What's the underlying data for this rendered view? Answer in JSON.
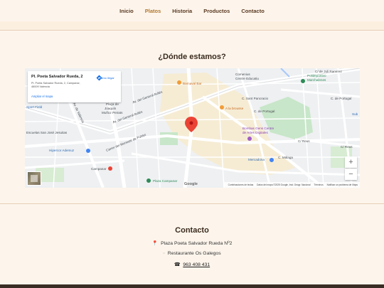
{
  "nav": {
    "items": [
      {
        "label": "Inicio"
      },
      {
        "label": "Platos",
        "active": true
      },
      {
        "label": "Historia"
      },
      {
        "label": "Productos"
      },
      {
        "label": "Contacto"
      }
    ]
  },
  "location": {
    "title": "¿Dónde estamos?",
    "map": {
      "place_name": "Pl. Poeta Salvador Rueda, 2",
      "place_address": "Pl. Poeta Salvador Rueda, 2, Campanar, 46009 Valencia",
      "directions_label": "Cómo llegar",
      "larger_map_label": "Ampliar el mapa",
      "zoom_in": "+",
      "zoom_out": "−",
      "attribution": {
        "shortcuts": "Combinaciones de teclas",
        "data": "Datos del mapa ©2025 Google, Inst. Geogr. Nacional",
        "terms": "Términos",
        "report": "Notificar un problema de Maps"
      },
      "google": "Google",
      "labels": {
        "carrer_de_juli_ramirez": "C/ de Juli Ramírez",
        "comenius": "Comenius",
        "centre_educatiu": "Centre Educatiu",
        "polideportivo": "Polideportivo",
        "marchalenes": "Marchalenes",
        "barnaval": "Barnaval Bar",
        "la_brousse": "A la brousse",
        "sant_pancracio": "C. Sant Pancracio",
        "portugal_1": "C. de Portugal",
        "portugal_2": "C. de Portugal",
        "sport_field": "Sport Field",
        "plaza_joaquin": "Plaça de",
        "plaza_joaquin_2": "Joaquín",
        "plaza_joaquin_3": "Muñoz Peirats",
        "ingeniero": "Escuelas San José Jesuitas",
        "bombas_gens": "Bombas Gens Centre",
        "bombas_gens_2": "de Artes Digitales",
        "hipercor": "Hipercor Ademuz",
        "campanar": "Campanar",
        "mercadona": "Mercadona",
        "plaza_campanar": "Plaza Campanar",
        "reus": "C/ Reus",
        "malaga": "C. Málaga",
        "av_general_aviles": "Av. del General Avilés",
        "av_general_aviles_2": "Av. del General Avilés",
        "av_valencia": "Av. de València",
        "monestir": "Carrer del Monestir de Poblet",
        "c_reus_2": "C/ Reus",
        "sub": "Sub"
      }
    }
  },
  "contact": {
    "title": "Contacto",
    "address": "Plaza Poeta Salvador Rueda Nº2",
    "restaurant": "Restaurante Os Galegos",
    "phone": "963 408 431",
    "address_icon": "pin-icon",
    "restaurant_icon": "building-icon",
    "phone_icon": "phone-icon"
  },
  "colors": {
    "accent": "#b07830",
    "nav_text": "#5a3a22",
    "background": "#fdf5ec",
    "footer": "#3a2d23",
    "pin": "#ea4335"
  }
}
